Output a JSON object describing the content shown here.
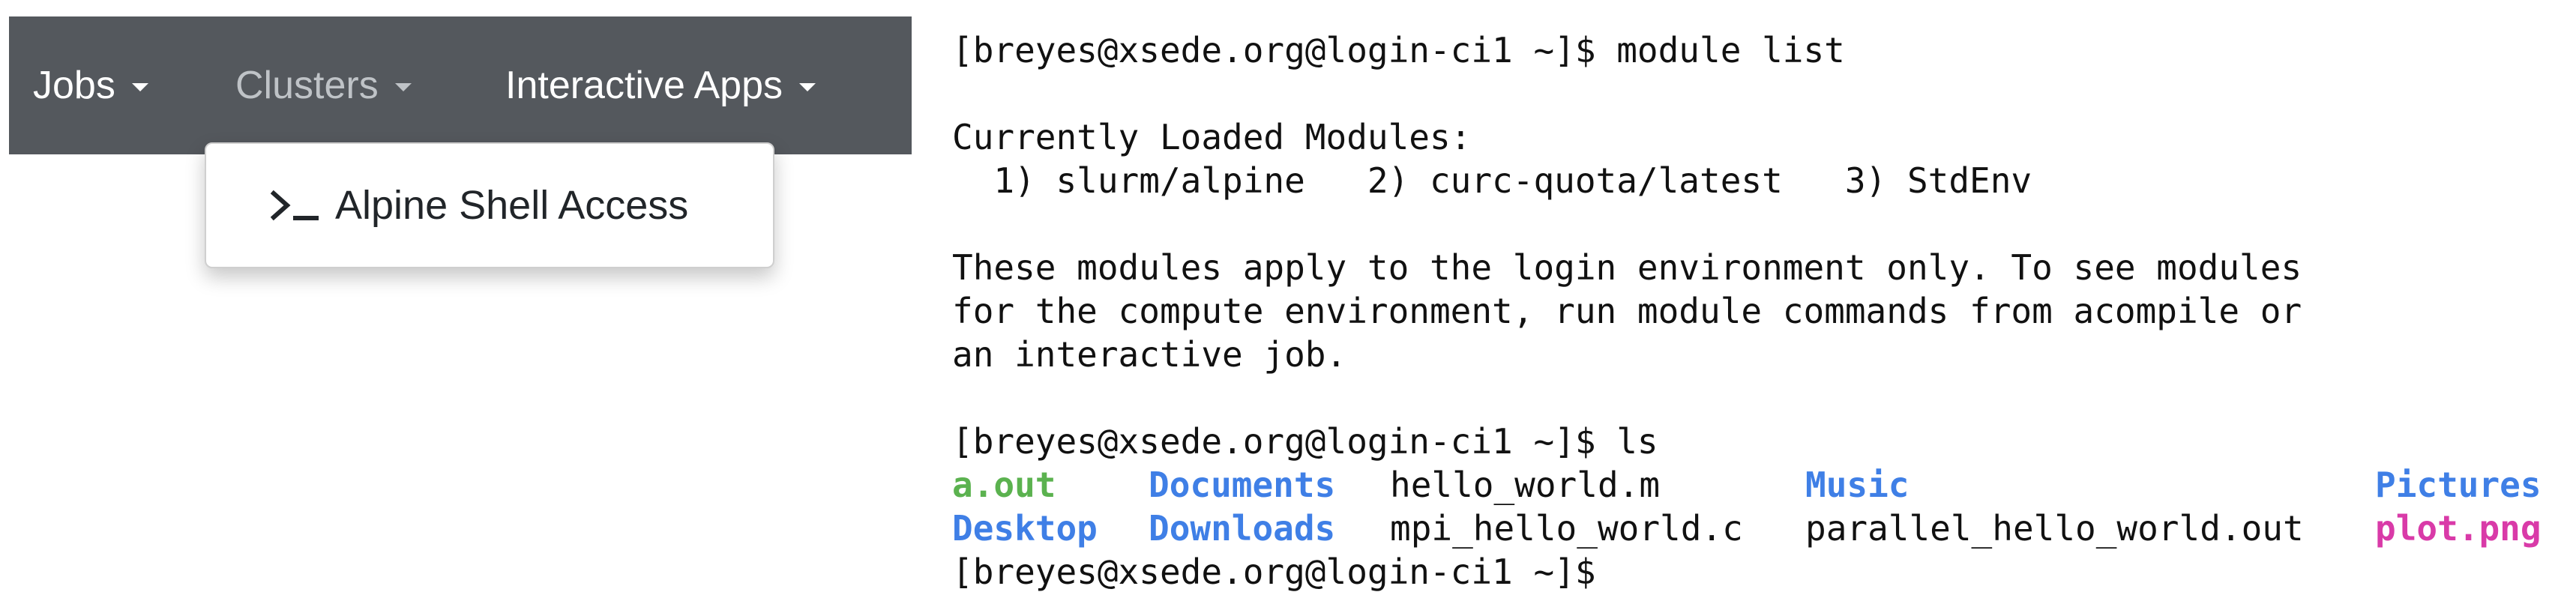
{
  "navbar": {
    "items": [
      {
        "label": "Jobs",
        "state": "active"
      },
      {
        "label": "Clusters",
        "state": "open"
      },
      {
        "label": "Interactive Apps",
        "state": "active"
      }
    ],
    "background": "#54585d"
  },
  "dropdown": {
    "items": [
      {
        "icon": "terminal-icon",
        "label": "Alpine Shell Access"
      }
    ]
  },
  "terminal": {
    "lines": [
      "[breyes@xsede.org@login-ci1 ~]$ module list",
      "",
      "Currently Loaded Modules:",
      "  1) slurm/alpine   2) curc-quota/latest   3) StdEnv",
      "",
      "These modules apply to the login environment only. To see modules",
      "for the compute environment, run module commands from acompile or",
      "an interactive job.",
      "",
      "[breyes@xsede.org@login-ci1 ~]$ ls"
    ],
    "ls_rows": [
      [
        {
          "name": "a.out",
          "type": "executable"
        },
        {
          "name": "Documents",
          "type": "directory"
        },
        {
          "name": "hello_world.m",
          "type": "file"
        },
        {
          "name": "Music",
          "type": "directory"
        },
        {
          "name": "Pictures",
          "type": "directory"
        }
      ],
      [
        {
          "name": "Desktop",
          "type": "directory"
        },
        {
          "name": "Downloads",
          "type": "directory"
        },
        {
          "name": "mpi_hello_world.c",
          "type": "file"
        },
        {
          "name": "parallel_hello_world.out",
          "type": "file"
        },
        {
          "name": "plot.png",
          "type": "image"
        }
      ]
    ],
    "final_prompt": "[breyes@xsede.org@login-ci1 ~]$ ",
    "colors": {
      "executable": "#5bb24f",
      "directory": "#3f7fe6",
      "image": "#d93aa8",
      "text": "#111111"
    }
  }
}
